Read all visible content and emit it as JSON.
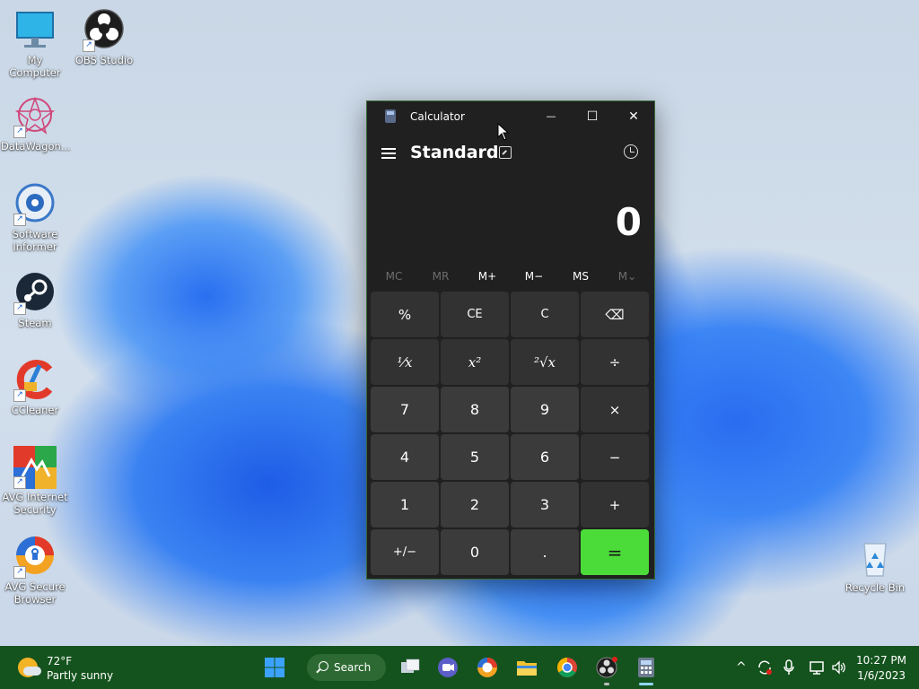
{
  "desktop": {
    "icons": [
      {
        "label": "My Computer"
      },
      {
        "label": "OBS Studio"
      },
      {
        "label": "DataWagon..."
      },
      {
        "label": "Software Informer"
      },
      {
        "label": "Steam"
      },
      {
        "label": "CCleaner"
      },
      {
        "label": "AVG Internet Security"
      },
      {
        "label": "AVG Secure Browser"
      },
      {
        "label": "Recycle Bin"
      }
    ]
  },
  "calculator": {
    "window_title": "Calculator",
    "mode": "Standard",
    "display_value": "0",
    "window_controls": {
      "minimize": "—",
      "maximize": "☐",
      "close": "✕"
    },
    "memory": [
      "MC",
      "MR",
      "M+",
      "M−",
      "MS",
      "M⌄"
    ],
    "keys": {
      "percent": "%",
      "ce": "CE",
      "c": "C",
      "backspace": "⌫",
      "reciprocal": "⅟x",
      "square": "x²",
      "sqrt": "²√x",
      "divide": "÷",
      "seven": "7",
      "eight": "8",
      "nine": "9",
      "multiply": "×",
      "four": "4",
      "five": "5",
      "six": "6",
      "minus": "−",
      "one": "1",
      "two": "2",
      "three": "3",
      "plus": "+",
      "negate": "+/−",
      "zero": "0",
      "decimal": ".",
      "equals": "="
    },
    "colors": {
      "equals_key": "#4cdc3a",
      "window_bg": "#202020"
    }
  },
  "taskbar": {
    "weather": {
      "temp": "72°F",
      "desc": "Partly sunny"
    },
    "search_label": "Search",
    "clock": {
      "time": "10:27 PM",
      "date": "1/6/2023"
    },
    "color": "#15531e",
    "tray_chevron": "^"
  }
}
